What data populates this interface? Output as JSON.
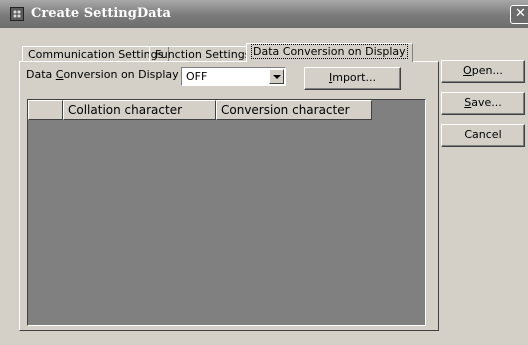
{
  "window": {
    "title": "Create SettingData",
    "close_label": "✕"
  },
  "tabs": [
    {
      "label": "Communication Settings",
      "active": false
    },
    {
      "label": "Function Settings",
      "active": false
    },
    {
      "label": "Data Conversion on Display",
      "active": true
    }
  ],
  "panel": {
    "label_pre": "Data ",
    "label_mnemonic": "C",
    "label_post": "onversion on Display",
    "select_value": "OFF",
    "import_mnemonic": "I",
    "import_rest": "mport..."
  },
  "grid": {
    "columns": [
      "",
      "Collation character",
      "Conversion character"
    ],
    "rows": []
  },
  "side_buttons": {
    "open_mnemonic": "O",
    "open_rest": "pen...",
    "save_mnemonic": "S",
    "save_rest": "ave...",
    "cancel": "Cancel"
  }
}
